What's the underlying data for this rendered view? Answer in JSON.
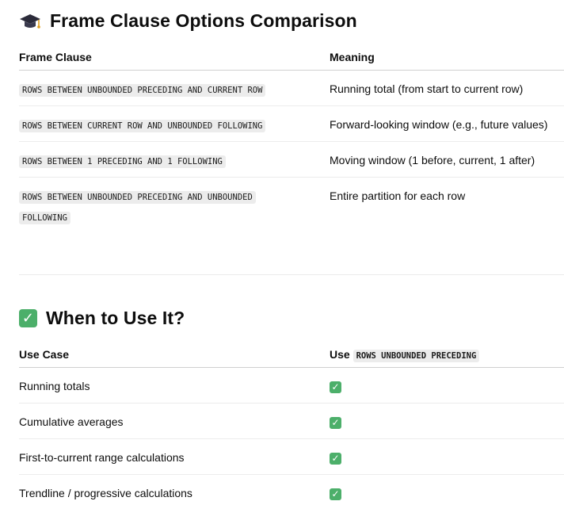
{
  "section1": {
    "icon": "graduation-cap-icon",
    "title": "Frame Clause Options Comparison",
    "headers": [
      "Frame Clause",
      "Meaning"
    ],
    "rows": [
      {
        "clause": "ROWS BETWEEN UNBOUNDED PRECEDING AND CURRENT ROW",
        "meaning": "Running total (from start to current row)"
      },
      {
        "clause": "ROWS BETWEEN CURRENT ROW AND UNBOUNDED FOLLOWING",
        "meaning": "Forward-looking window (e.g., future values)"
      },
      {
        "clause": "ROWS BETWEEN 1 PRECEDING AND 1 FOLLOWING",
        "meaning": "Moving window (1 before, current, 1 after)"
      },
      {
        "clause": "ROWS BETWEEN UNBOUNDED PRECEDING AND UNBOUNDED FOLLOWING",
        "meaning": "Entire partition for each row"
      }
    ]
  },
  "section2": {
    "icon": "check-mark-button-icon",
    "title": "When to Use It?",
    "headers": {
      "use_case": "Use Case",
      "use_prefix": "Use",
      "use_code": "ROWS UNBOUNDED PRECEDING"
    },
    "rows": [
      {
        "use_case": "Running totals",
        "check": "✓"
      },
      {
        "use_case": "Cumulative averages",
        "check": "✓"
      },
      {
        "use_case": "First-to-current range calculations",
        "check": "✓"
      },
      {
        "use_case": "Trendline / progressive calculations",
        "check": "✓"
      }
    ]
  },
  "colors": {
    "check_green": "#4caf6a",
    "code_bg": "#ececec"
  }
}
